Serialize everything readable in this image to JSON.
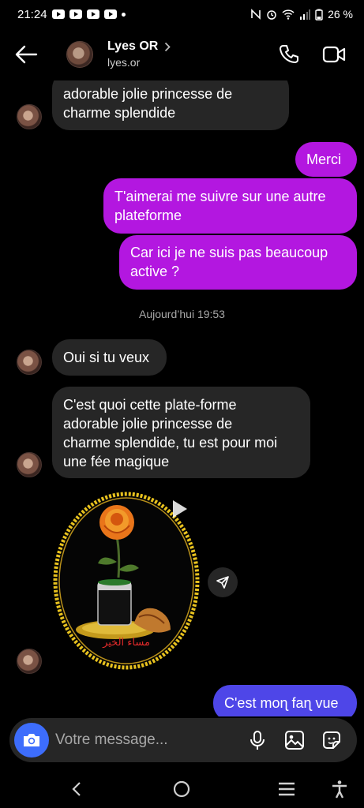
{
  "status": {
    "time": "21:24",
    "battery": "26 %"
  },
  "header": {
    "name": "Lyes OR",
    "handle": "lyes.or"
  },
  "messages": {
    "m1_line1": "adorable jolie princesse de",
    "m1_line2": "charme splendide",
    "m2": "Merci",
    "m3_line1": "T'aimerai me suivre sur une autre",
    "m3_line2": "plateforme",
    "m4_line1": "Car ici je ne suis pas beaucoup",
    "m4_line2": "active ?",
    "timestamp": "Aujourd’hui 19:53",
    "m5": "Oui si tu veux",
    "m6_line1": "C'est quoi cette plate-forme",
    "m6_line2": "adorable jolie princesse de",
    "m6_line3": "charme splendide, tu est pour moi",
    "m6_line4": "une fée magique",
    "sticker_text": "مساء الخير",
    "m7": "C'est moɳ faɳ vue"
  },
  "composer": {
    "placeholder": "Votre message..."
  },
  "colors": {
    "bubble_in": "#262626",
    "bubble_out": "#b317e0",
    "bubble_out_alt": "#4e46e8",
    "camera_button": "#3d6dfc"
  },
  "icons": [
    "back-arrow-icon",
    "chevron-right-icon",
    "phone-icon",
    "video-camera-icon",
    "play-icon",
    "send-icon",
    "camera-icon",
    "microphone-icon",
    "image-icon",
    "sticker-icon",
    "nav-back-icon",
    "nav-home-icon",
    "nav-recents-icon",
    "accessibility-icon"
  ]
}
